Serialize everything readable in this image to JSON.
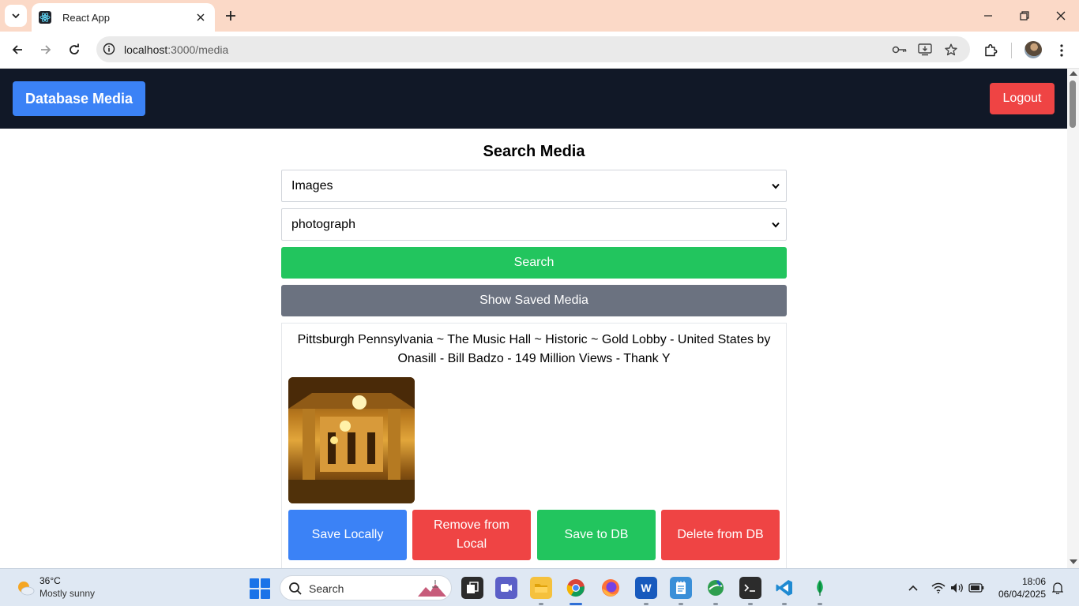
{
  "browser": {
    "tab_title": "React App",
    "url_host": "localhost",
    "url_path": ":3000/media"
  },
  "app": {
    "brand_label": "Database Media",
    "logout_label": "Logout",
    "search_title": "Search Media",
    "media_type_select": {
      "selected": "Images"
    },
    "query_select": {
      "selected": "photograph"
    },
    "search_button_label": "Search",
    "show_saved_label": "Show Saved Media",
    "media_card": {
      "caption": "Pittsburgh Pennsylvania ~ The Music Hall ~ Historic ~ Gold Lobby - United States by Onasill - Bill Badzo - 149 Million Views - Thank Y",
      "buttons": {
        "save_locally": "Save Locally",
        "remove_local": "Remove from Local",
        "save_db": "Save to DB",
        "delete_db": "Delete from DB"
      }
    },
    "colors": {
      "header_bg": "#111827",
      "primary_blue": "#3b82f6",
      "danger_red": "#ef4444",
      "success_green": "#22c55e",
      "neutral_gray": "#6b7280"
    }
  },
  "taskbar": {
    "weather_temp": "36°C",
    "weather_desc": "Mostly sunny",
    "search_placeholder": "Search",
    "time": "18:06",
    "date": "06/04/2025",
    "apps": [
      "task-view",
      "teams-meet",
      "file-explorer",
      "chrome",
      "firefox",
      "word",
      "notepad",
      "app-globe",
      "terminal",
      "vscode",
      "mongodb-compass"
    ]
  }
}
